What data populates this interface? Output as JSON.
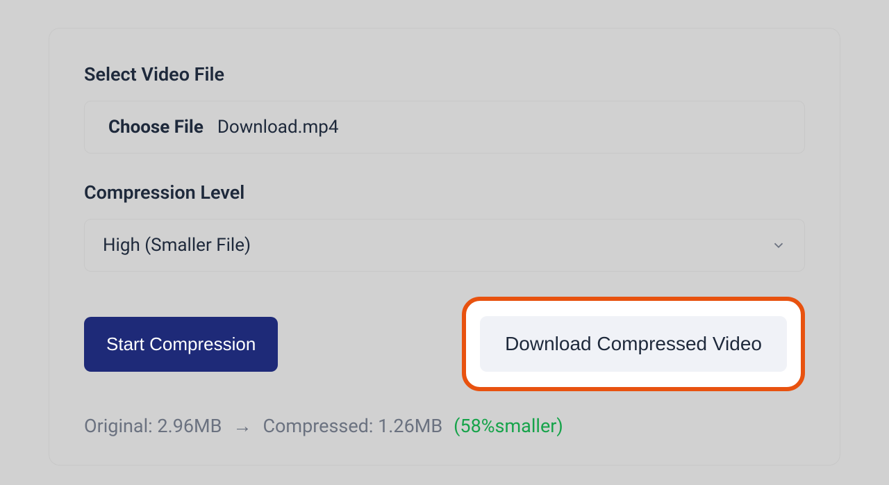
{
  "labels": {
    "select_file": "Select Video File",
    "choose_file": "Choose File",
    "compression_level": "Compression Level"
  },
  "file": {
    "name": "Download.mp4"
  },
  "compression": {
    "selected": "High (Smaller File)"
  },
  "buttons": {
    "start": "Start Compression",
    "download": "Download Compressed Video"
  },
  "stats": {
    "original": "Original: 2.96MB",
    "arrow": "→",
    "compressed": "Compressed: 1.26MB",
    "reduction": "(58%smaller)"
  }
}
